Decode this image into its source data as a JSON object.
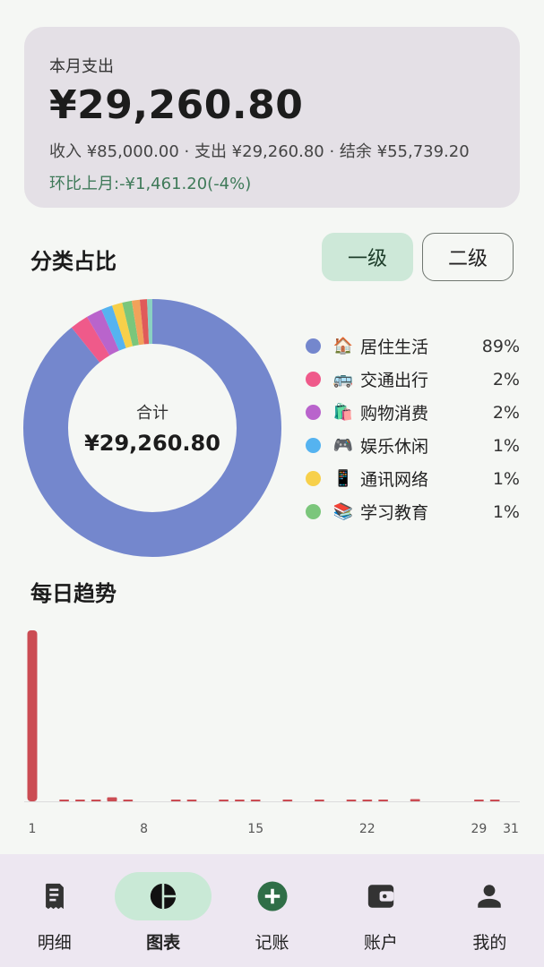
{
  "summary": {
    "label": "本月支出",
    "amount": "¥29,260.80",
    "detail": "收入 ¥85,000.00 · 支出 ¥29,260.80 · 结余 ¥55,739.20",
    "compare": "环比上月:-¥1,461.20(-4%)"
  },
  "category": {
    "title": "分类占比",
    "level1_label": "一级",
    "level2_label": "二级",
    "center_label": "合计",
    "center_value": "¥29,260.80",
    "items": [
      {
        "icon": "🏠",
        "icon_name": "house-icon",
        "name": "居住生活",
        "pct": "89%",
        "color": "#7487cd"
      },
      {
        "icon": "🚌",
        "icon_name": "bus-icon",
        "name": "交通出行",
        "pct": "2%",
        "color": "#ef5a8a"
      },
      {
        "icon": "🛍️",
        "icon_name": "shopping-bags-icon",
        "name": "购物消费",
        "pct": "2%",
        "color": "#b964cc"
      },
      {
        "icon": "🎮",
        "icon_name": "game-controller-icon",
        "name": "娱乐休闲",
        "pct": "1%",
        "color": "#55b3f0"
      },
      {
        "icon": "📱",
        "icon_name": "mobile-phone-icon",
        "name": "通讯网络",
        "pct": "1%",
        "color": "#f7d04a"
      },
      {
        "icon": "📚",
        "icon_name": "books-icon",
        "name": "学习教育",
        "pct": "1%",
        "color": "#7bc67b"
      }
    ],
    "extra_slice_colors": [
      "#f2a25a",
      "#e05a5a",
      "#8ad1c2"
    ]
  },
  "trend": {
    "title": "每日趋势",
    "bar_color": "#cb4c53",
    "axis_color": "#dcdcdc"
  },
  "chart_data": [
    {
      "type": "pie",
      "title": "",
      "categories": [
        "居住生活",
        "交通出行",
        "购物消费",
        "娱乐休闲",
        "通讯网络",
        "学习教育",
        "",
        "",
        ""
      ],
      "values": [
        89.2,
        2.3,
        2.0,
        1.4,
        1.3,
        1.2,
        1.0,
        0.9,
        0.7
      ]
    },
    {
      "type": "bar",
      "title": "",
      "x": [
        1,
        2,
        3,
        4,
        5,
        6,
        7,
        8,
        9,
        10,
        11,
        12,
        13,
        14,
        15,
        16,
        17,
        18,
        19,
        20,
        21,
        22,
        23,
        24,
        25,
        26,
        27,
        28,
        29,
        30,
        31
      ],
      "tick_labels": [
        "1",
        "8",
        "15",
        "22",
        "29",
        "31"
      ],
      "tick_days": [
        1,
        8,
        15,
        22,
        29,
        31
      ],
      "values": [
        21000,
        0,
        80,
        90,
        85,
        500,
        120,
        0,
        0,
        90,
        100,
        0,
        70,
        75,
        100,
        0,
        110,
        0,
        80,
        0,
        140,
        130,
        140,
        0,
        280,
        0,
        0,
        0,
        70,
        160,
        0
      ],
      "ylim": [
        0,
        21000
      ]
    }
  ],
  "nav": {
    "items": [
      {
        "label": "明细",
        "icon_name": "receipt-icon"
      },
      {
        "label": "图表",
        "icon_name": "pie-chart-icon"
      },
      {
        "label": "记账",
        "icon_name": "add-circle-icon"
      },
      {
        "label": "账户",
        "icon_name": "wallet-icon"
      },
      {
        "label": "我的",
        "icon_name": "person-icon"
      }
    ],
    "active_index": 1,
    "accent": "#2f6e47"
  }
}
